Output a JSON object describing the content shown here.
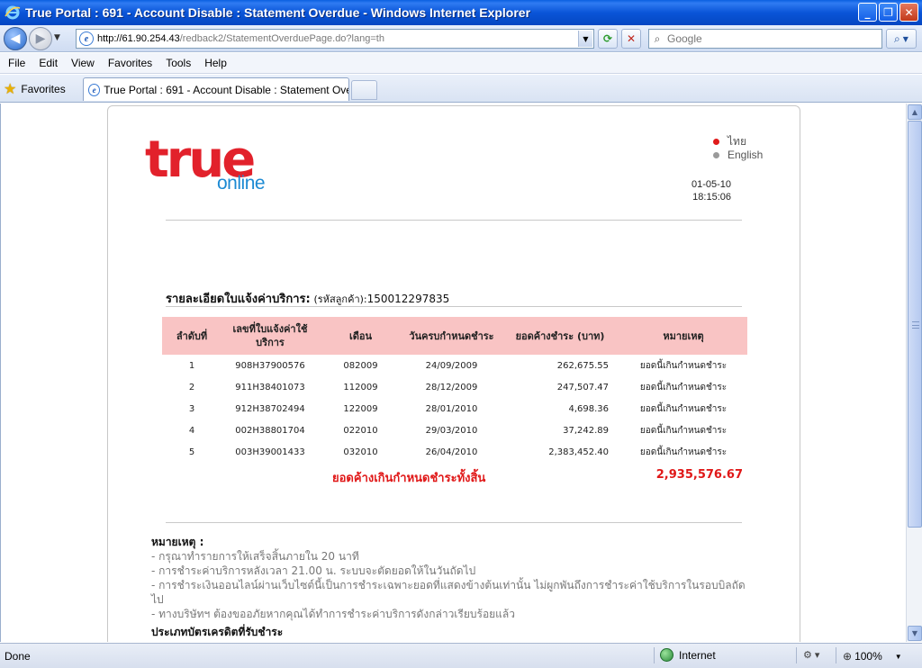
{
  "window": {
    "title": "True Portal : 691 - Account Disable : Statement Overdue - Windows Internet Explorer"
  },
  "address": {
    "host": "http://61.90.254.43",
    "path": "/redback2/StatementOverduePage.do?lang=th"
  },
  "search": {
    "placeholder": "Google"
  },
  "menu": {
    "file": "File",
    "edit": "Edit",
    "view": "View",
    "favorites": "Favorites",
    "tools": "Tools",
    "help": "Help"
  },
  "favbar": {
    "favorites_label": "Favorites",
    "tab_title": "True Portal : 691 - Account Disable : Statement Over..."
  },
  "page": {
    "logo_word": "true",
    "logo_sub": "online",
    "lang_thai": "ไทย",
    "lang_english": "English",
    "date": "01-05-10",
    "time": "18:15:06",
    "statement_title": "รายละเอียดใบแจ้งค่าบริการ:",
    "customer_label": "(รหัสลูกค้า):",
    "customer_id": "150012297835",
    "table": {
      "headers": [
        "ลำดับที่",
        "เลขที่ใบแจ้งค่าใช้บริการ",
        "เดือน",
        "วันครบกำหนดชำระ",
        "ยอดค้างชำระ (บาท)",
        "หมายเหตุ"
      ],
      "rows": [
        {
          "no": "1",
          "invoice": "908H37900576",
          "month": "082009",
          "due": "24/09/2009",
          "amount": "262,675.55",
          "note": "ยอดนี้เกินกำหนดชำระ"
        },
        {
          "no": "2",
          "invoice": "911H38401073",
          "month": "112009",
          "due": "28/12/2009",
          "amount": "247,507.47",
          "note": "ยอดนี้เกินกำหนดชำระ"
        },
        {
          "no": "3",
          "invoice": "912H38702494",
          "month": "122009",
          "due": "28/01/2010",
          "amount": "4,698.36",
          "note": "ยอดนี้เกินกำหนดชำระ"
        },
        {
          "no": "4",
          "invoice": "002H38801704",
          "month": "022010",
          "due": "29/03/2010",
          "amount": "37,242.89",
          "note": "ยอดนี้เกินกำหนดชำระ"
        },
        {
          "no": "5",
          "invoice": "003H39001433",
          "month": "032010",
          "due": "26/04/2010",
          "amount": "2,383,452.40",
          "note": "ยอดนี้เกินกำหนดชำระ"
        }
      ]
    },
    "total_label": "ยอดค้างเกินกำหนดชำระทั้งสิ้น",
    "total_value": "2,935,576.67",
    "notes_title": "หมายเหตุ :",
    "notes": [
      "- กรุณาทำรายการให้เสร็จสิ้นภายใน 20 นาที",
      "- การชำระค่าบริการหลังเวลา 21.00 น. ระบบจะตัดยอดให้ในวันถัดไป",
      "- การชำระเงินออนไลน์ผ่านเว็บไซต์นี้เป็นการชำระเฉพาะยอดที่แสดงข้างต้นเท่านั้น ไม่ผูกพันถึงการชำระค่าใช้บริการในรอบบิลถัดไป",
      "- ทางบริษัทฯ ต้องขออภัยหากคุณได้ทำการชำระค่าบริการดังกล่าวเรียบร้อยแล้ว"
    ],
    "card_title": "ประเภทบัตรเครดิตที่รับชำระ"
  },
  "status": {
    "done": "Done",
    "zone": "Internet",
    "zoom": "100%"
  },
  "colors": {
    "title_bar": "#0a55d8",
    "table_header": "#f9c4c4",
    "total_red": "#e01818",
    "logo_red": "#e2212b",
    "logo_blue": "#1c8ad3"
  }
}
